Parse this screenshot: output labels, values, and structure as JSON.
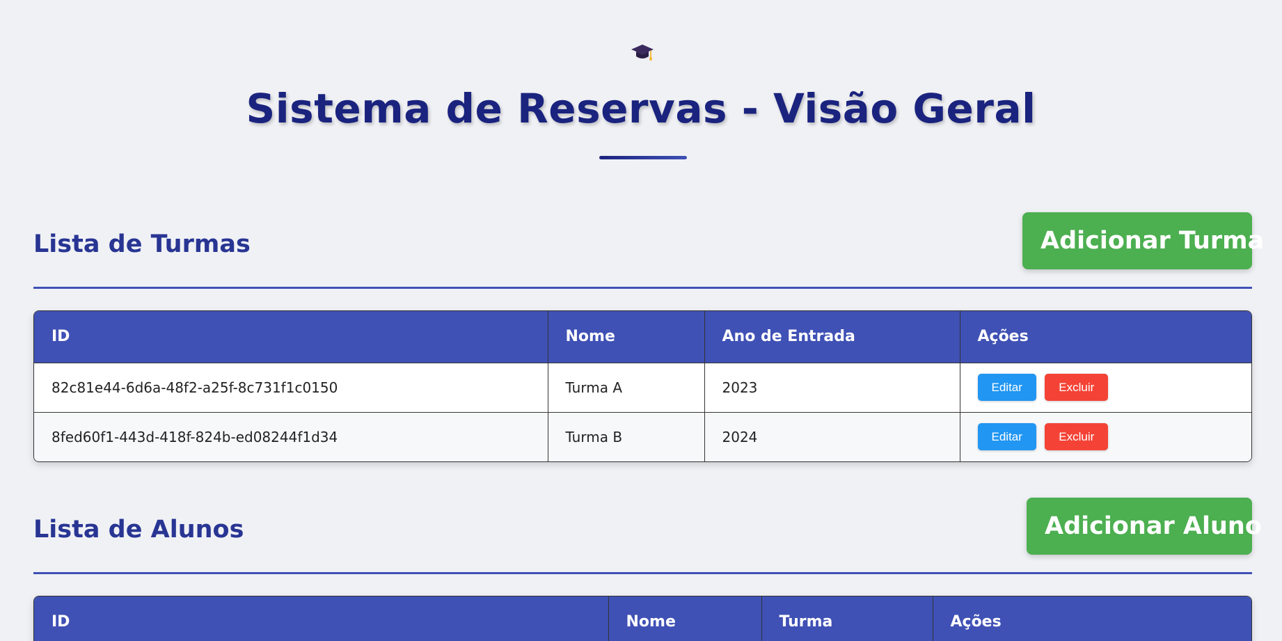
{
  "header": {
    "icon": "graduation-cap-icon",
    "title": "Sistema de Reservas - Visão Geral"
  },
  "turmas": {
    "title": "Lista de Turmas",
    "add_label": "Adicionar Turma",
    "columns": [
      "ID",
      "Nome",
      "Ano de Entrada",
      "Ações"
    ],
    "rows": [
      {
        "id": "82c81e44-6d6a-48f2-a25f-8c731f1c0150",
        "nome": "Turma A",
        "ano": "2023"
      },
      {
        "id": "8fed60f1-443d-418f-824b-ed08244f1d34",
        "nome": "Turma B",
        "ano": "2024"
      }
    ]
  },
  "alunos": {
    "title": "Lista de Alunos",
    "add_label": "Adicionar Aluno",
    "columns": [
      "ID",
      "Nome",
      "Turma",
      "Ações"
    ]
  },
  "actions": {
    "edit_label": "Editar",
    "delete_label": "Excluir"
  },
  "colors": {
    "title": "#1a237e",
    "section_title": "#283593",
    "table_header": "#3f51b5",
    "add_button": "#4caf50",
    "edit_button": "#2196f3",
    "delete_button": "#f44336",
    "background": "#f0f1f5"
  }
}
